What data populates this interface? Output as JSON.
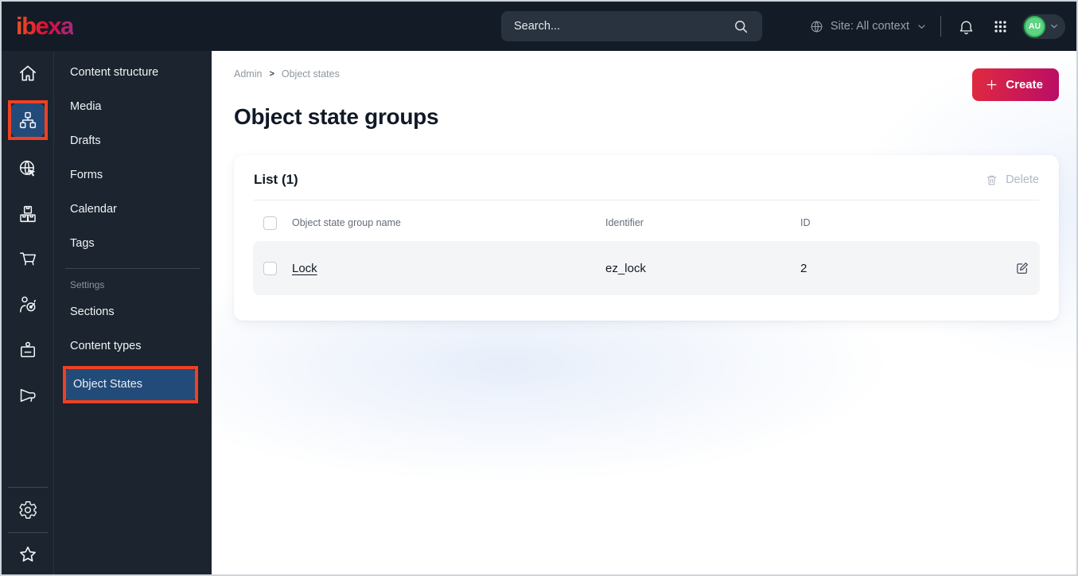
{
  "topbar": {
    "logo": "ibexa",
    "search_placeholder": "Search...",
    "site_context_label": "Site: All context",
    "avatar_initials": "AU"
  },
  "icon_rail": {
    "items": [
      {
        "icon": "home-icon",
        "active": false
      },
      {
        "icon": "content-structure-icon",
        "active": true,
        "annotated": true
      },
      {
        "icon": "site-icon",
        "active": false
      },
      {
        "icon": "product-catalog-icon",
        "active": false
      },
      {
        "icon": "commerce-cart-icon",
        "active": false
      },
      {
        "icon": "personalization-icon",
        "active": false
      },
      {
        "icon": "customer-portal-icon",
        "active": false
      },
      {
        "icon": "campaign-icon",
        "active": false
      }
    ],
    "bottom_items": [
      {
        "icon": "settings-gear-icon"
      },
      {
        "icon": "bookmarks-star-icon"
      }
    ]
  },
  "sidebar": {
    "items": [
      "Content structure",
      "Media",
      "Drafts",
      "Forms",
      "Calendar",
      "Tags"
    ],
    "settings_label": "Settings",
    "settings_items": [
      "Sections",
      "Content types",
      "Object States"
    ],
    "active_item": "Object States"
  },
  "main": {
    "breadcrumb": [
      "Admin",
      "Object states"
    ],
    "breadcrumb_separator": ">",
    "title": "Object state groups",
    "create_label": "Create",
    "panel": {
      "title": "List (1)",
      "delete_label": "Delete",
      "columns": [
        "Object state group name",
        "Identifier",
        "ID"
      ],
      "rows": [
        {
          "name": "Lock",
          "identifier": "ez_lock",
          "id": "2"
        }
      ]
    }
  },
  "colors": {
    "topbar_bg": "#131c26",
    "sidebar_bg": "#1b242f",
    "active_item_bg": "#224b79",
    "annotation_highlight": "#ee4123",
    "create_gradient_start": "#e02a3f",
    "create_gradient_end": "#ba0d66",
    "brand_gradient": [
      "#f0511f",
      "#e00a3c",
      "#a42a80"
    ],
    "avatar_green": "#5ed381",
    "row_bg": "#f4f5f7",
    "page_tint": "#e7eefa"
  }
}
